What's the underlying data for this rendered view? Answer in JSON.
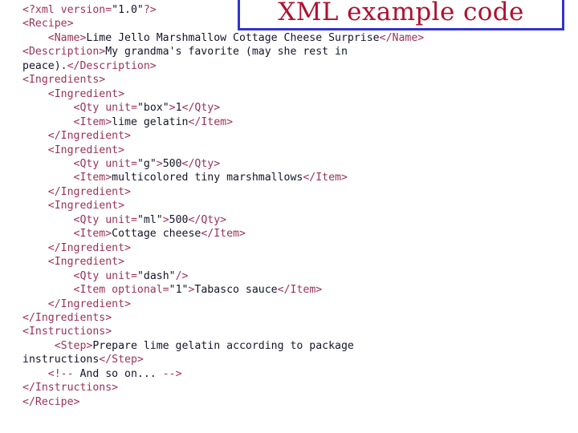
{
  "title_banner": {
    "text": "XML example code",
    "border_color": "#3333cc",
    "text_color": "#b01030",
    "background": "#ffffff"
  },
  "colors": {
    "tag": "#993355",
    "content": "#14142b",
    "page_background": "#ffffff"
  },
  "code": {
    "language": "xml",
    "lines": [
      {
        "id": "line-1",
        "indent": "",
        "segments": [
          {
            "t": "tag",
            "v": "<?xml version="
          },
          {
            "t": "txt",
            "v": "\"1.0\""
          },
          {
            "t": "tag",
            "v": "?>"
          }
        ]
      },
      {
        "id": "line-2",
        "indent": "",
        "segments": [
          {
            "t": "tag",
            "v": "<Recipe>"
          }
        ]
      },
      {
        "id": "line-3",
        "indent": "    ",
        "segments": [
          {
            "t": "tag",
            "v": "<Name>"
          },
          {
            "t": "txt",
            "v": "Lime Jello Marshmallow Cottage Cheese Surprise"
          },
          {
            "t": "tag",
            "v": "</Name>"
          }
        ]
      },
      {
        "id": "line-4",
        "indent": "",
        "segments": [
          {
            "t": "tag",
            "v": "<Description>"
          },
          {
            "t": "txt",
            "v": "My grandma's favorite (may she rest in"
          }
        ]
      },
      {
        "id": "line-5",
        "indent": "",
        "segments": [
          {
            "t": "txt",
            "v": "peace)."
          },
          {
            "t": "tag",
            "v": "</Description>"
          }
        ]
      },
      {
        "id": "line-6",
        "indent": "",
        "segments": [
          {
            "t": "tag",
            "v": "<Ingredients>"
          }
        ]
      },
      {
        "id": "line-7",
        "indent": "    ",
        "segments": [
          {
            "t": "tag",
            "v": "<Ingredient>"
          }
        ]
      },
      {
        "id": "line-8",
        "indent": "        ",
        "segments": [
          {
            "t": "tag",
            "v": "<Qty unit="
          },
          {
            "t": "txt",
            "v": "\"box\""
          },
          {
            "t": "tag",
            "v": ">"
          },
          {
            "t": "txt",
            "v": "1"
          },
          {
            "t": "tag",
            "v": "</Qty>"
          }
        ]
      },
      {
        "id": "line-9",
        "indent": "        ",
        "segments": [
          {
            "t": "tag",
            "v": "<Item>"
          },
          {
            "t": "txt",
            "v": "lime gelatin"
          },
          {
            "t": "tag",
            "v": "</Item>"
          }
        ]
      },
      {
        "id": "line-10",
        "indent": "    ",
        "segments": [
          {
            "t": "tag",
            "v": "</Ingredient>"
          }
        ]
      },
      {
        "id": "line-11",
        "indent": "    ",
        "segments": [
          {
            "t": "tag",
            "v": "<Ingredient>"
          }
        ]
      },
      {
        "id": "line-12",
        "indent": "        ",
        "segments": [
          {
            "t": "tag",
            "v": "<Qty unit="
          },
          {
            "t": "txt",
            "v": "\"g\""
          },
          {
            "t": "tag",
            "v": ">"
          },
          {
            "t": "txt",
            "v": "500"
          },
          {
            "t": "tag",
            "v": "</Qty>"
          }
        ]
      },
      {
        "id": "line-13",
        "indent": "        ",
        "segments": [
          {
            "t": "tag",
            "v": "<Item>"
          },
          {
            "t": "txt",
            "v": "multicolored tiny marshmallows"
          },
          {
            "t": "tag",
            "v": "</Item>"
          }
        ]
      },
      {
        "id": "line-14",
        "indent": "    ",
        "segments": [
          {
            "t": "tag",
            "v": "</Ingredient>"
          }
        ]
      },
      {
        "id": "line-15",
        "indent": "    ",
        "segments": [
          {
            "t": "tag",
            "v": "<Ingredient>"
          }
        ]
      },
      {
        "id": "line-16",
        "indent": "        ",
        "segments": [
          {
            "t": "tag",
            "v": "<Qty unit="
          },
          {
            "t": "txt",
            "v": "\"ml\""
          },
          {
            "t": "tag",
            "v": ">"
          },
          {
            "t": "txt",
            "v": "500"
          },
          {
            "t": "tag",
            "v": "</Qty>"
          }
        ]
      },
      {
        "id": "line-17",
        "indent": "        ",
        "segments": [
          {
            "t": "tag",
            "v": "<Item>"
          },
          {
            "t": "txt",
            "v": "Cottage cheese"
          },
          {
            "t": "tag",
            "v": "</Item>"
          }
        ]
      },
      {
        "id": "line-18",
        "indent": "    ",
        "segments": [
          {
            "t": "tag",
            "v": "</Ingredient>"
          }
        ]
      },
      {
        "id": "line-19",
        "indent": "    ",
        "segments": [
          {
            "t": "tag",
            "v": "<Ingredient>"
          }
        ]
      },
      {
        "id": "line-20",
        "indent": "        ",
        "segments": [
          {
            "t": "tag",
            "v": "<Qty unit="
          },
          {
            "t": "txt",
            "v": "\"dash\""
          },
          {
            "t": "tag",
            "v": "/>"
          }
        ]
      },
      {
        "id": "line-21",
        "indent": "        ",
        "segments": [
          {
            "t": "tag",
            "v": "<Item optional="
          },
          {
            "t": "txt",
            "v": "\"1\""
          },
          {
            "t": "tag",
            "v": ">"
          },
          {
            "t": "txt",
            "v": "Tabasco sauce"
          },
          {
            "t": "tag",
            "v": "</Item>"
          }
        ]
      },
      {
        "id": "line-22",
        "indent": "    ",
        "segments": [
          {
            "t": "tag",
            "v": "</Ingredient>"
          }
        ]
      },
      {
        "id": "line-23",
        "indent": "",
        "segments": [
          {
            "t": "tag",
            "v": "</Ingredients>"
          }
        ]
      },
      {
        "id": "line-24",
        "indent": "",
        "segments": [
          {
            "t": "tag",
            "v": "<Instructions>"
          }
        ]
      },
      {
        "id": "line-25",
        "indent": "     ",
        "segments": [
          {
            "t": "tag",
            "v": "<Step>"
          },
          {
            "t": "txt",
            "v": "Prepare lime gelatin according to package"
          }
        ]
      },
      {
        "id": "line-26",
        "indent": "",
        "segments": [
          {
            "t": "txt",
            "v": "instructions"
          },
          {
            "t": "tag",
            "v": "</Step>"
          }
        ]
      },
      {
        "id": "line-27",
        "indent": "    ",
        "segments": [
          {
            "t": "comment-delim",
            "v": "<!--"
          },
          {
            "t": "comment-body",
            "v": " And so on... "
          },
          {
            "t": "comment-delim",
            "v": "-->"
          }
        ]
      },
      {
        "id": "line-28",
        "indent": "",
        "segments": [
          {
            "t": "tag",
            "v": "</Instructions>"
          }
        ]
      },
      {
        "id": "line-29",
        "indent": "",
        "segments": [
          {
            "t": "tag",
            "v": "</Recipe>"
          }
        ]
      }
    ]
  }
}
